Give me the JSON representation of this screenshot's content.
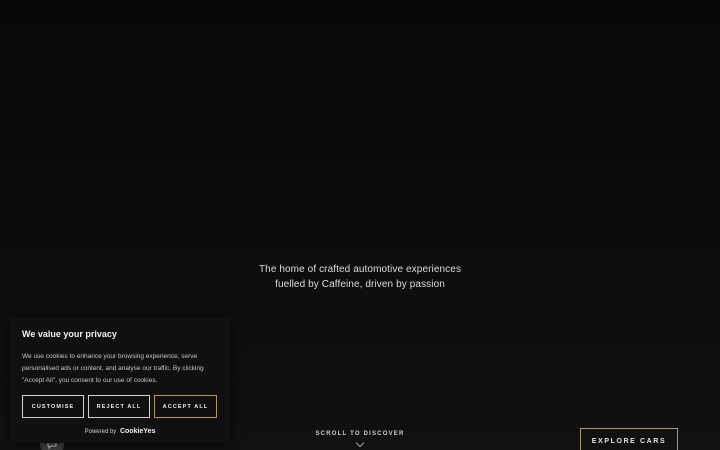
{
  "hero": {
    "tagline_line1": "The home of crafted automotive experiences",
    "tagline_line2": "fuelled by Caffeine, driven by passion"
  },
  "scroll": {
    "label": "SCROLL TO DISCOVER",
    "icon": "chevron-down-icon"
  },
  "cta": {
    "explore_label": "EXPLORE CARS"
  },
  "chat": {
    "icon": "chat-bubble-icon"
  },
  "cookie_banner": {
    "title": "We value your privacy",
    "text": "We use cookies to enhance your browsing experience, serve personalised ads or content, and analyse our traffic. By clicking \"Accept All\", you consent to our use of cookies.",
    "customise_label": "CUSTOMISE",
    "reject_label": "REJECT ALL",
    "accept_label": "ACCEPT ALL",
    "powered_by": "Powered by",
    "brand": "CookieYes"
  },
  "colors": {
    "background": "#0d0d0e",
    "accent_gold": "#b59a5e",
    "banner_bg": "#101011"
  }
}
